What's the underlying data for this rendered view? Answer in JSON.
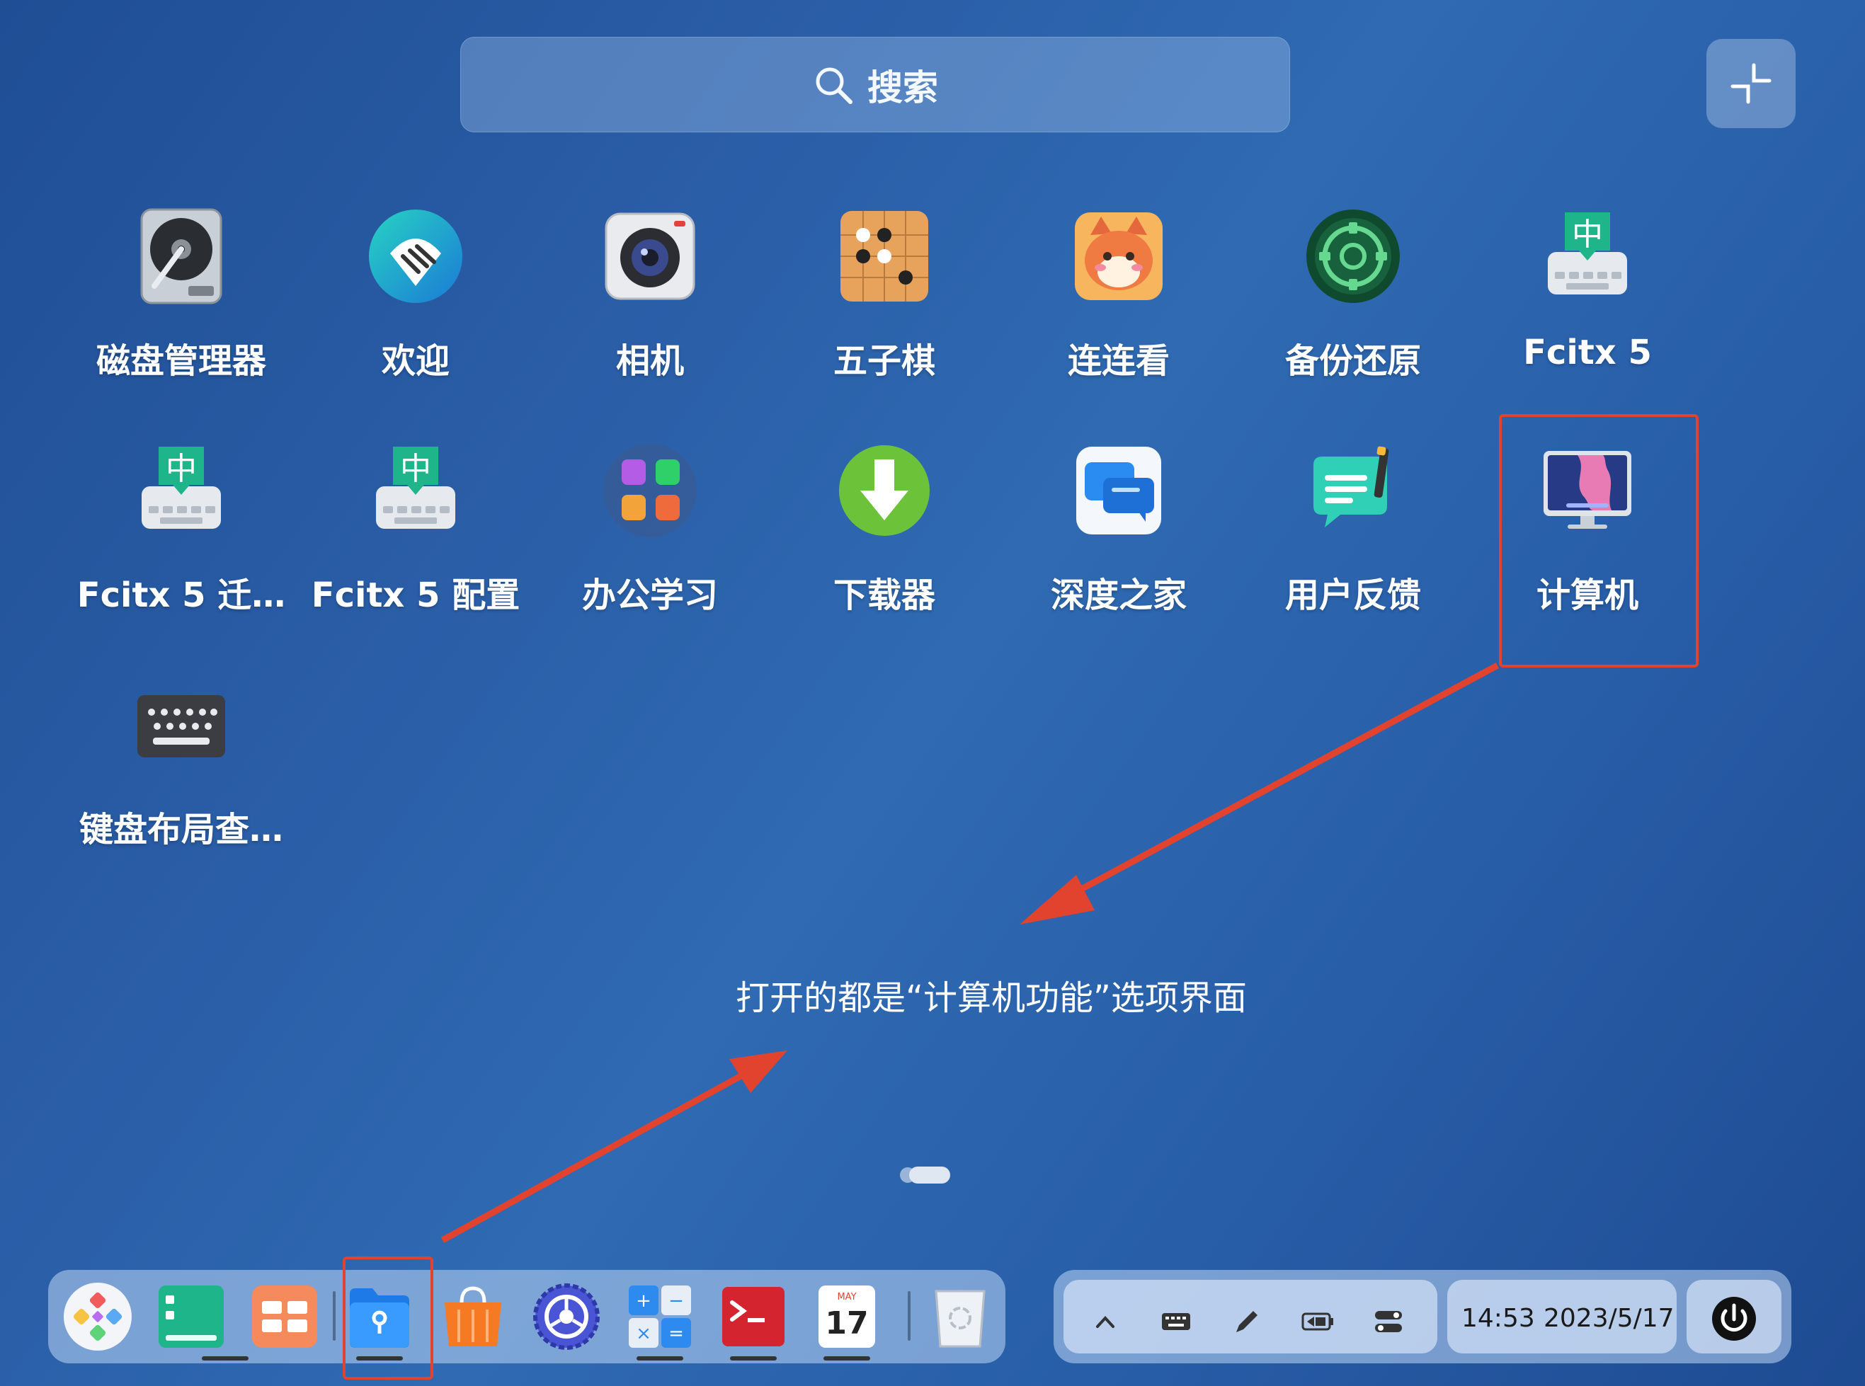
{
  "search": {
    "label": "搜索",
    "icon": "search-icon"
  },
  "corner_button": {
    "icon": "exit-fullscreen-icon"
  },
  "apps": [
    {
      "label": "磁盘管理器",
      "icon": "disk-manager-icon"
    },
    {
      "label": "欢迎",
      "icon": "welcome-icon"
    },
    {
      "label": "相机",
      "icon": "camera-icon"
    },
    {
      "label": "五子棋",
      "icon": "gomoku-icon"
    },
    {
      "label": "连连看",
      "icon": "lianliankan-icon"
    },
    {
      "label": "备份还原",
      "icon": "backup-restore-icon"
    },
    {
      "label": "Fcitx 5",
      "icon": "fcitx-icon"
    },
    {
      "label": "Fcitx 5 迁…",
      "icon": "fcitx-migrator-icon"
    },
    {
      "label": "Fcitx 5 配置",
      "icon": "fcitx-config-icon"
    },
    {
      "label": "办公学习",
      "icon": "office-folder-icon"
    },
    {
      "label": "下载器",
      "icon": "downloader-icon"
    },
    {
      "label": "深度之家",
      "icon": "deepin-home-icon"
    },
    {
      "label": "用户反馈",
      "icon": "feedback-icon"
    },
    {
      "label": "计算机",
      "icon": "computer-icon"
    },
    {
      "label": "键盘布局查…",
      "icon": "keyboard-layout-icon"
    }
  ],
  "annotation": "打开的都是“计算机功能”选项界面",
  "annotation_color": "#e2432f",
  "dock": [
    {
      "icon": "launcher-icon"
    },
    {
      "icon": "multitask-view-icon"
    },
    {
      "icon": "workspace-icon"
    },
    {
      "icon": "file-manager-icon"
    },
    {
      "icon": "app-store-icon"
    },
    {
      "icon": "control-center-icon"
    },
    {
      "icon": "calculator-icon"
    },
    {
      "icon": "terminal-icon"
    },
    {
      "icon": "calendar-icon",
      "month": "MAY",
      "day": "17"
    },
    {
      "icon": "trash-icon"
    }
  ],
  "tray": {
    "icons": [
      "chevron-up-icon",
      "keyboard-icon",
      "pen-icon",
      "battery-icon",
      "toggles-icon"
    ],
    "time": "14:53",
    "date": "2023/5/17",
    "power_icon": "power-icon"
  }
}
